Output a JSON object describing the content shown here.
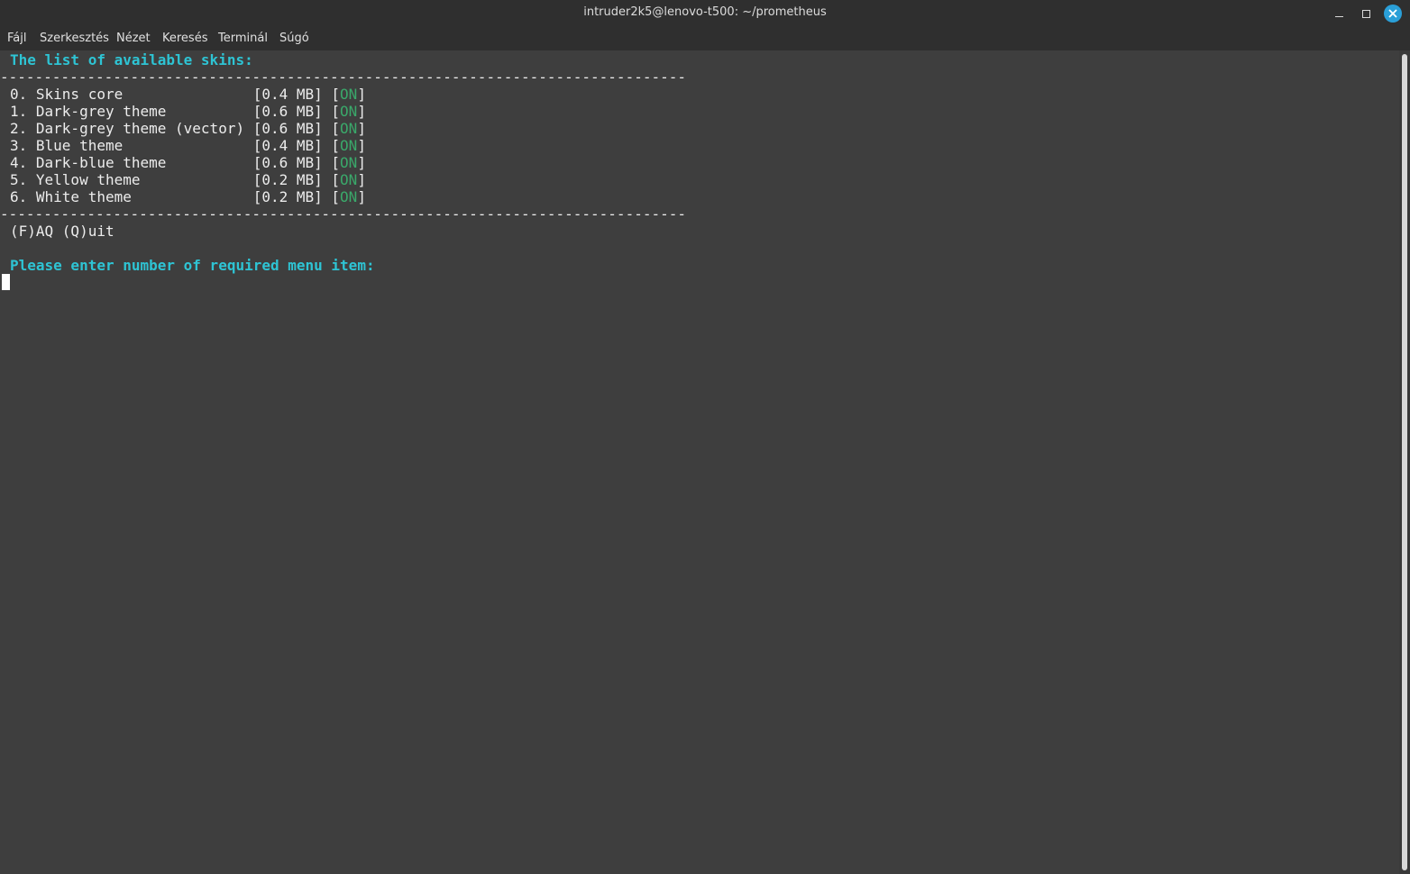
{
  "window": {
    "title": "intruder2k5@lenovo-t500: ~/prometheus"
  },
  "menubar": {
    "items": [
      "Fájl",
      "Szerkesztés",
      "Nézet",
      "Keresés",
      "Terminál",
      "Súgó"
    ]
  },
  "terminal": {
    "heading": "The list of available skins:",
    "separator": "-------------------------------------------------------------------------------",
    "items": [
      {
        "label": "0. Skins core               [0.4 MB] [",
        "status": "ON",
        "close": "]"
      },
      {
        "label": "1. Dark-grey theme          [0.6 MB] [",
        "status": "ON",
        "close": "]"
      },
      {
        "label": "2. Dark-grey theme (vector) [0.6 MB] [",
        "status": "ON",
        "close": "]"
      },
      {
        "label": "3. Blue theme               [0.4 MB] [",
        "status": "ON",
        "close": "]"
      },
      {
        "label": "4. Dark-blue theme          [0.6 MB] [",
        "status": "ON",
        "close": "]"
      },
      {
        "label": "5. Yellow theme             [0.2 MB] [",
        "status": "ON",
        "close": "]"
      },
      {
        "label": "6. White theme              [0.2 MB] [",
        "status": "ON",
        "close": "]"
      }
    ],
    "options": "(F)AQ (Q)uit",
    "prompt": "Please enter number of required menu item:"
  },
  "colors": {
    "heading": "#2ec4d4",
    "status_on": "#3aa86a",
    "background": "#3e3e3e",
    "close_button": "#2a9fd8"
  },
  "icons": {
    "minimize": "minimize-icon",
    "maximize": "maximize-icon",
    "close": "close-icon"
  }
}
